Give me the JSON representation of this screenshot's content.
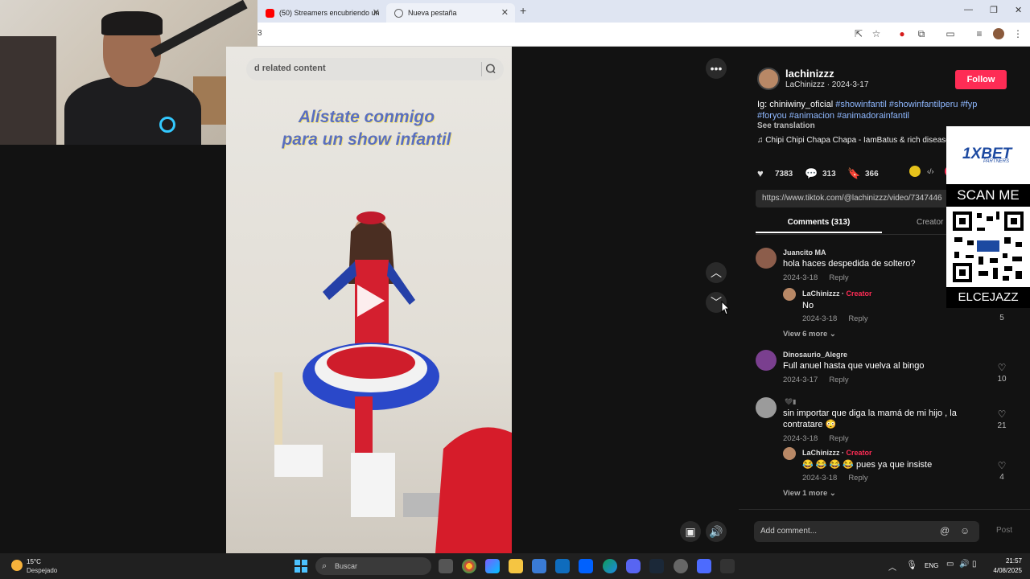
{
  "browser": {
    "tabs": [
      {
        "label": "(50) Streamers encubriendo un"
      },
      {
        "label": "Nueva pestaña"
      }
    ],
    "address_fragment": "3"
  },
  "video": {
    "search_placeholder": "d related content",
    "overlay_line1": "Alístate conmigo",
    "overlay_line2": "para un show infantil"
  },
  "post": {
    "username": "lachinizzz",
    "subline": "LaChinizzz · 2024-3-17",
    "follow_label": "Follow",
    "caption_prefix": "Ig: chiniwiny_oficial",
    "hashtags": [
      "#showinfantil",
      "#showinfantilperu",
      "#fyp",
      "#foryou",
      "#animacion",
      "#animadorainfantil"
    ],
    "see_translation": "See translation",
    "music": "Chipi Chipi Chapa Chapa - IamBatus & rich disease",
    "likes": "7383",
    "comments_count": "313",
    "saves": "366",
    "link": "https://www.tiktok.com/@lachinizzz/video/7347446"
  },
  "tabs": {
    "comments": "Comments (313)",
    "creator": "Creator"
  },
  "comments": [
    {
      "name": "Juancito MA",
      "text": "hola haces despedida de soltero?",
      "date": "2024-3-18",
      "reply": "Reply",
      "likes": ""
    },
    {
      "name": "LaChinizzz",
      "tag": "Creator",
      "text": "No",
      "date": "2024-3-18",
      "reply": "Reply",
      "likes": "5"
    },
    {
      "view_more": "View 6 more"
    },
    {
      "name": "Dinosaurio_Alegre",
      "text": "Full anuel hasta que vuelva al bingo",
      "date": "2024-3-17",
      "reply": "Reply",
      "likes": "10"
    },
    {
      "name": "",
      "text": "sin importar que diga la mamá de mi hijo , la contratare 😳",
      "date": "2024-3-18",
      "reply": "Reply",
      "likes": "21"
    },
    {
      "name": "LaChinizzz",
      "tag": "Creator",
      "text": "😂 😂 😂 😂  pues ya que insiste",
      "date": "2024-3-18",
      "reply": "Reply",
      "likes": "4"
    },
    {
      "view_more": "View 1 more"
    }
  ],
  "comment_box": {
    "placeholder": "Add comment...",
    "post_label": "Post"
  },
  "ad": {
    "brand": "1XBET",
    "partners": "PARTNERS",
    "scan": "SCAN ME",
    "name": "ELCEJAZZ"
  },
  "taskbar": {
    "temp": "15°C",
    "weather": "Despejado",
    "search": "Buscar",
    "lang": "ENG",
    "time": "21:57",
    "date": "4/08/2025"
  }
}
